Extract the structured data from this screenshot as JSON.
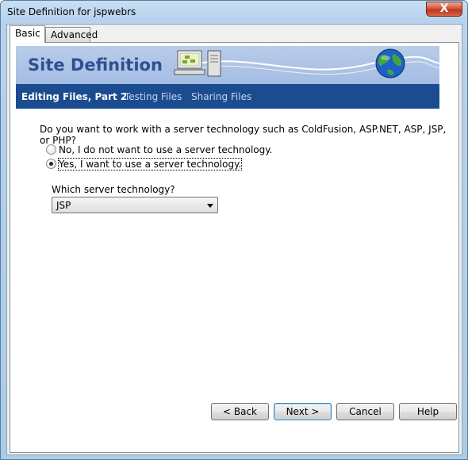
{
  "window": {
    "title": "Site Definition for jspwebrs",
    "close_label": "X"
  },
  "tabs": [
    {
      "label": "Basic",
      "active": true
    },
    {
      "label": "Advanced",
      "active": false
    }
  ],
  "banner": {
    "title": "Site Definition"
  },
  "subnav": {
    "current": "Editing Files, Part 2",
    "items": [
      "Testing Files",
      "Sharing Files"
    ]
  },
  "form": {
    "question": "Do you want to work with a server technology such as ColdFusion, ASP.NET, ASP, JSP, or PHP?",
    "option_no": "No, I do not want to use a server technology.",
    "option_yes": "Yes, I want to use a server technology.",
    "selected_option": "yes",
    "server_label": "Which server technology?",
    "server_value": "JSP"
  },
  "buttons": {
    "back": "< Back",
    "next": "Next >",
    "cancel": "Cancel",
    "help": "Help"
  },
  "colors": {
    "banner_bg": "#a9c0e5",
    "subnav_bg": "#1c4c90",
    "banner_title": "#2f4f8f"
  }
}
